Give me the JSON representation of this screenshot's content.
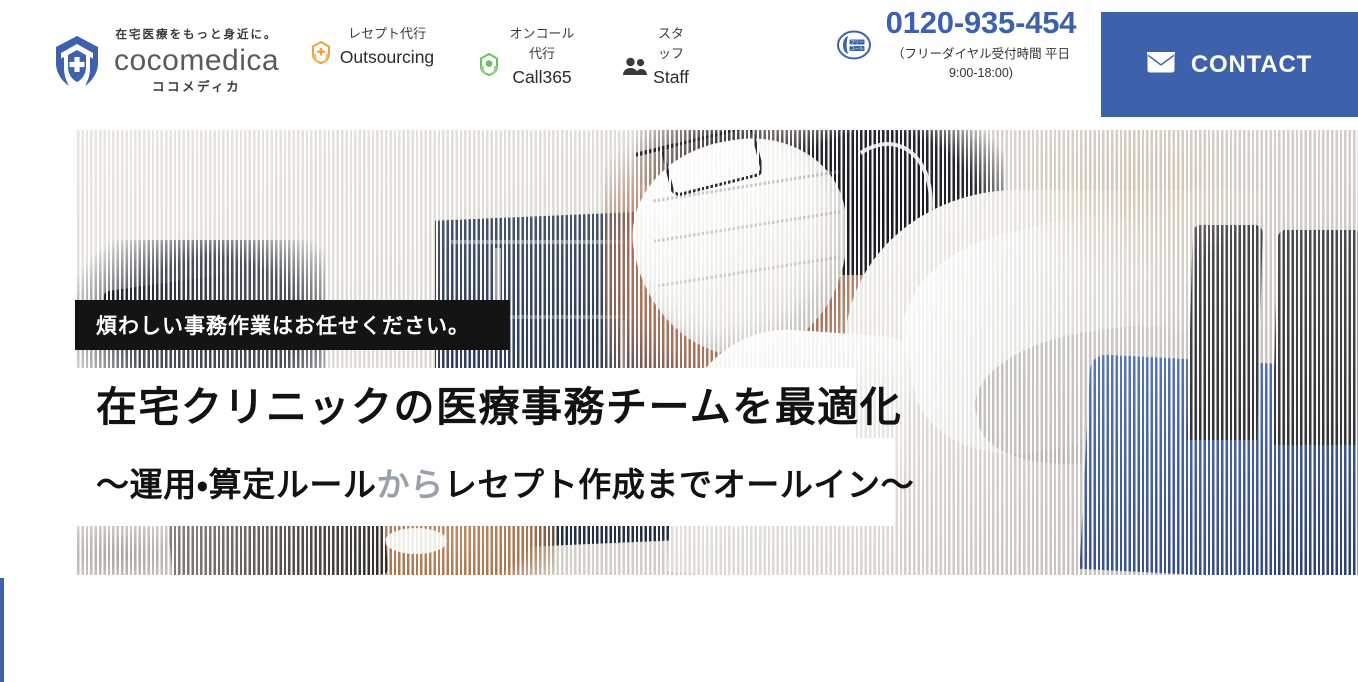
{
  "header": {
    "logo": {
      "tagline": "在宅医療をもっと身近に。",
      "name": "cocomedica",
      "kana": "ココメディカ",
      "icon": "shield-hands-cross-icon"
    },
    "nav": [
      {
        "ja": "レセプト代行",
        "en": "Outsourcing",
        "icon": "hex-cross-hands-orange-icon",
        "color": "#f0a03c"
      },
      {
        "ja": "オンコール代行",
        "en": "Call365",
        "icon": "hex-cross-hands-green-icon",
        "color": "#6cbf63"
      },
      {
        "ja": "スタッフ",
        "en": "Staff",
        "icon": "people-icon",
        "color": "#3a3a3a"
      }
    ],
    "phone": {
      "icon": "freecall-icon",
      "number": "0120-935-454",
      "hours": "（フリーダイヤル受付時間 平日9:00-18:00)",
      "color": "#3d62ab"
    },
    "contact": {
      "label": "CONTACT",
      "icon": "envelope-icon",
      "background": "#3d62ab"
    }
  },
  "hero": {
    "badge": "煩わしい事務作業はお任せください。",
    "title": "在宅クリニックの医療事務チームを最適化",
    "subtitle_pre": "～運用・算定ルール",
    "subtitle_muted": "から",
    "subtitle_post": "レセプト作成までオールイン～",
    "image_alt": "在宅医療スタッフが電話対応している写真",
    "accent_color": "#3d62ab"
  }
}
